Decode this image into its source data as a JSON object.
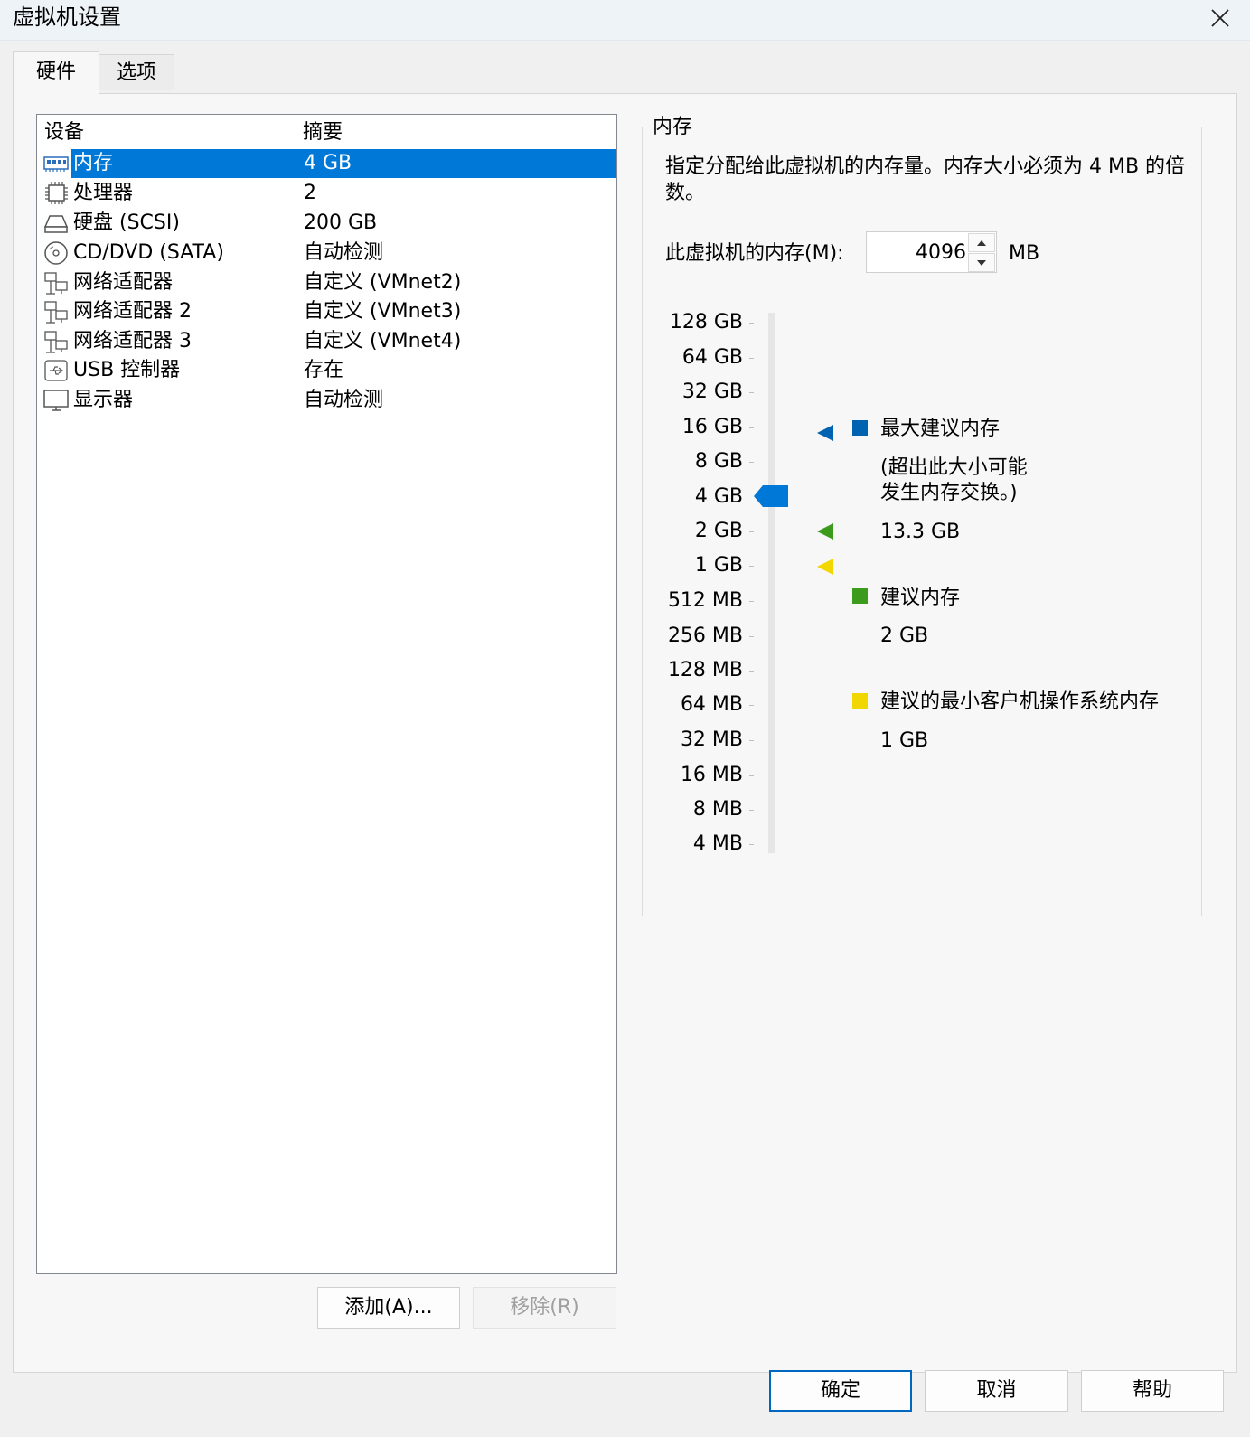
{
  "window": {
    "title": "虚拟机设置"
  },
  "tabs": [
    {
      "label": "硬件"
    },
    {
      "label": "选项"
    }
  ],
  "device_list": {
    "headers": {
      "device": "设备",
      "summary": "摘要"
    },
    "rows": [
      {
        "icon": "memory-icon",
        "name": "内存",
        "summary": "4 GB"
      },
      {
        "icon": "processor-icon",
        "name": "处理器",
        "summary": "2"
      },
      {
        "icon": "hard-disk-icon",
        "name": "硬盘 (SCSI)",
        "summary": "200 GB"
      },
      {
        "icon": "cd-dvd-icon",
        "name": "CD/DVD (SATA)",
        "summary": "自动检测"
      },
      {
        "icon": "network-adapter-icon",
        "name": "网络适配器",
        "summary": "自定义 (VMnet2)"
      },
      {
        "icon": "network-adapter-icon",
        "name": "网络适配器 2",
        "summary": "自定义 (VMnet3)"
      },
      {
        "icon": "network-adapter-icon",
        "name": "网络适配器 3",
        "summary": "自定义 (VMnet4)"
      },
      {
        "icon": "usb-icon",
        "name": "USB 控制器",
        "summary": "存在"
      },
      {
        "icon": "display-icon",
        "name": "显示器",
        "summary": "自动检测"
      }
    ]
  },
  "list_buttons": {
    "add": "添加(A)...",
    "remove": "移除(R)"
  },
  "memory": {
    "group_title": "内存",
    "description": "指定分配给此虚拟机的内存量。内存大小必须为 4 MB 的倍数。",
    "field_label": "此虚拟机的内存(M):",
    "value": "4096",
    "unit": "MB",
    "scale": [
      "128 GB",
      "64 GB",
      "32 GB",
      "16 GB",
      "8 GB",
      "4 GB",
      "2 GB",
      "1 GB",
      "512 MB",
      "256 MB",
      "128 MB",
      "64 MB",
      "32 MB",
      "16 MB",
      "8 MB",
      "4 MB"
    ],
    "current_level": "4 GB",
    "legend": {
      "max": {
        "title": "最大建议内存",
        "note_line1": "(超出此大小可能",
        "note_line2": "发生内存交换。)",
        "value": "13.3 GB",
        "color": "#0063b1"
      },
      "recommended": {
        "title": "建议内存",
        "value": "2 GB",
        "color": "#3c9a1c"
      },
      "min_guest": {
        "title": "建议的最小客户机操作系统内存",
        "value": "1 GB",
        "color": "#f2d600"
      }
    },
    "thumb_color": "#0078d7"
  },
  "footer": {
    "ok": "确定",
    "cancel": "取消",
    "help": "帮助"
  }
}
